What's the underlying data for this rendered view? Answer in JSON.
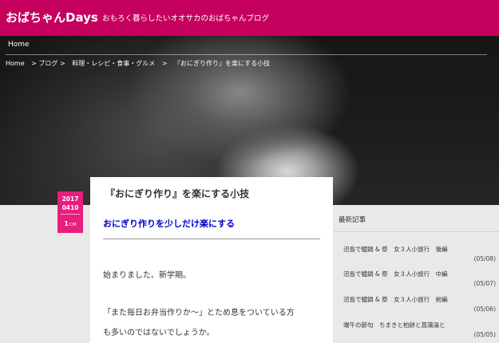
{
  "site": {
    "title": "おばちゃんDays",
    "description": "おもろく暮らしたいオオサカのおばちゃんブログ"
  },
  "nav": {
    "home_label": "Home"
  },
  "breadcrumb": {
    "items": [
      "Home",
      "> ブログ >",
      "料理・レシピ・食事・グルメ",
      ">",
      "『おにぎり作り』を楽にする小技"
    ]
  },
  "post": {
    "year": "2017",
    "month_day": "0410",
    "comment_count": "1",
    "comment_unit": "CM",
    "title": "『おにぎり作り』を楽にする小技",
    "subtitle": "おにぎり作りを少しだけ楽にする",
    "paragraphs": [
      "始まりました、新学期。",
      "「また毎日お弁当作りか〜」とため息をついている方",
      "も多いのではないでしょうか。"
    ]
  },
  "sidebar": {
    "title": "最新記事",
    "items": [
      {
        "title": "沼島で鱧鍋 & 祭　女３人小旅行　後編",
        "date": "(05/08)"
      },
      {
        "title": "沼島で鱧鍋 & 祭　女３人小旅行　中編",
        "date": "(05/07)"
      },
      {
        "title": "沼島で鱧鍋 & 祭　女３人小旅行　前編",
        "date": "(05/06)"
      },
      {
        "title": "端午の節句　ちまきと柏餅と菖蒲湯と",
        "date": "(05/05)"
      }
    ]
  }
}
